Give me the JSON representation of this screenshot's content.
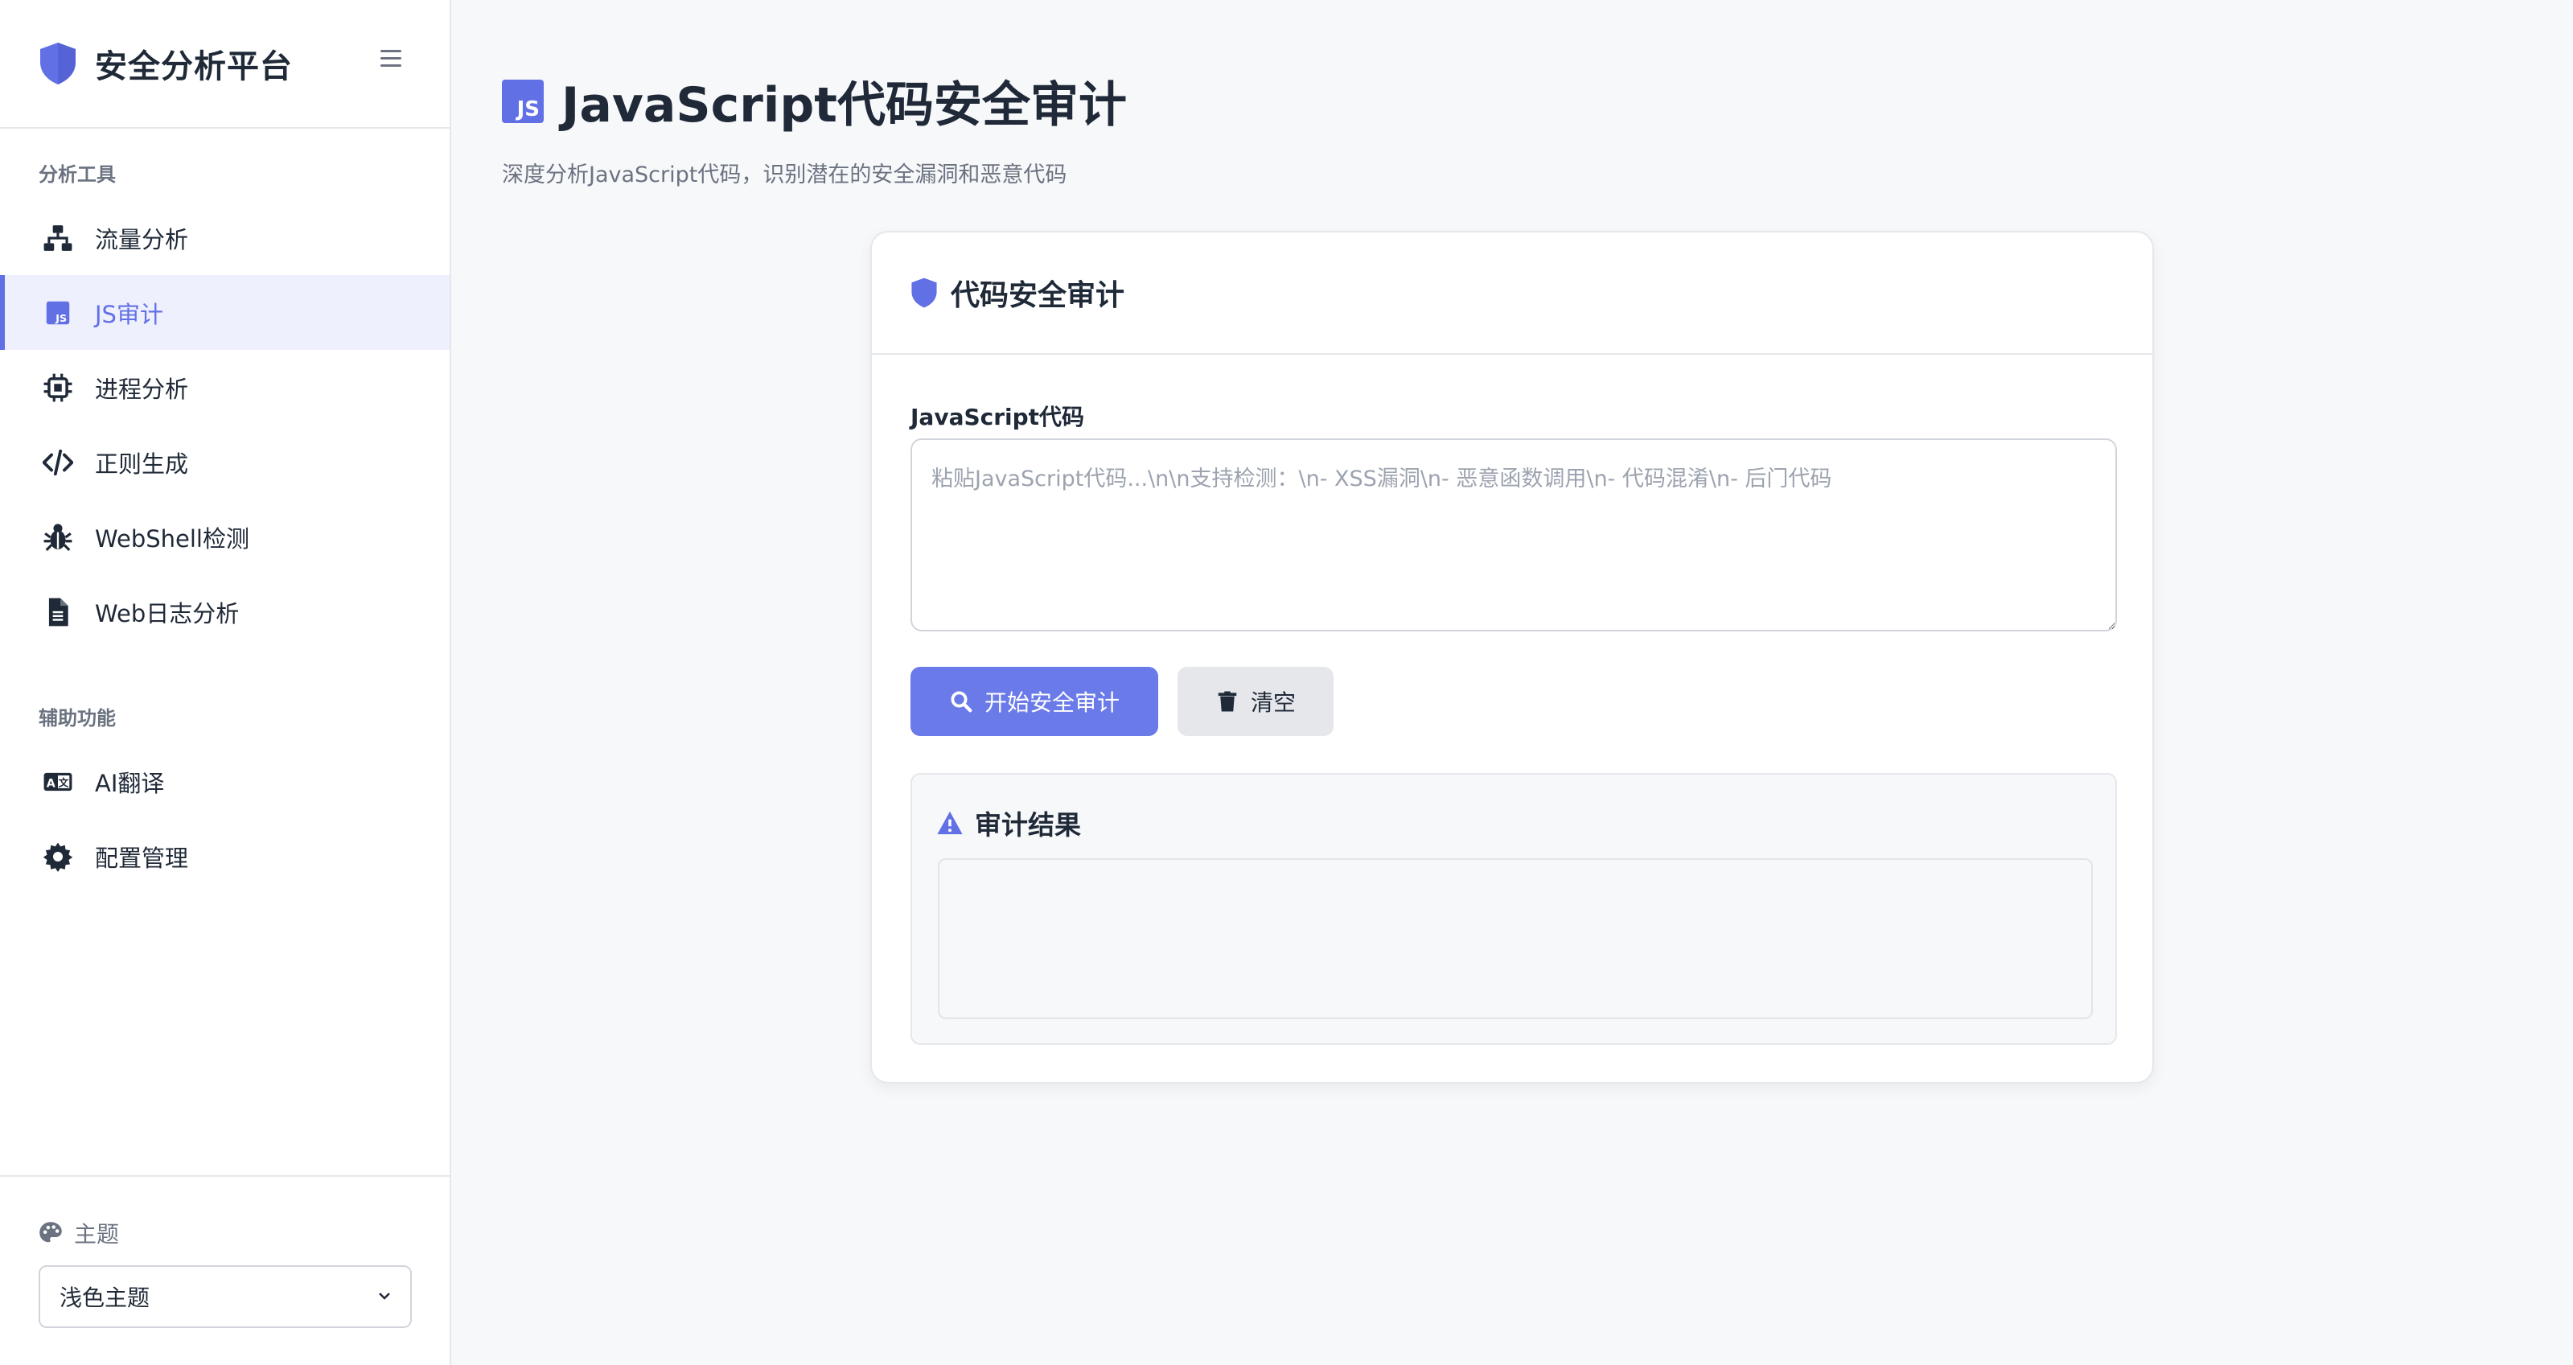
{
  "app": {
    "title": "安全分析平台"
  },
  "sidebar": {
    "sections": [
      {
        "title": "分析工具",
        "items": [
          {
            "label": "流量分析",
            "icon": "network-icon",
            "active": false
          },
          {
            "label": "JS审计",
            "icon": "js-icon",
            "active": true
          },
          {
            "label": "进程分析",
            "icon": "cpu-icon",
            "active": false
          },
          {
            "label": "正则生成",
            "icon": "code-icon",
            "active": false
          },
          {
            "label": "WebShell检测",
            "icon": "bug-icon",
            "active": false
          },
          {
            "label": "Web日志分析",
            "icon": "file-icon",
            "active": false
          }
        ]
      },
      {
        "title": "辅助功能",
        "items": [
          {
            "label": "AI翻译",
            "icon": "language-icon",
            "active": false
          },
          {
            "label": "配置管理",
            "icon": "gear-icon",
            "active": false
          }
        ]
      }
    ],
    "theme": {
      "label": "主题",
      "selected": "浅色主题"
    }
  },
  "main": {
    "title": "JavaScript代码安全审计",
    "badge": "JS",
    "subtitle": "深度分析JavaScript代码，识别潜在的安全漏洞和恶意代码",
    "card": {
      "title": "代码安全审计",
      "field_label": "JavaScript代码",
      "placeholder": "粘贴JavaScript代码...\\n\\n支持检测：\\n- XSS漏洞\\n- 恶意函数调用\\n- 代码混淆\\n- 后门代码",
      "value": "",
      "start_button": "开始安全审计",
      "clear_button": "清空",
      "result_title": "审计结果",
      "result_text": ""
    }
  },
  "colors": {
    "accent": "#6270e6",
    "button_primary": "#6a7ae8",
    "active_bg": "#eef0fd"
  }
}
